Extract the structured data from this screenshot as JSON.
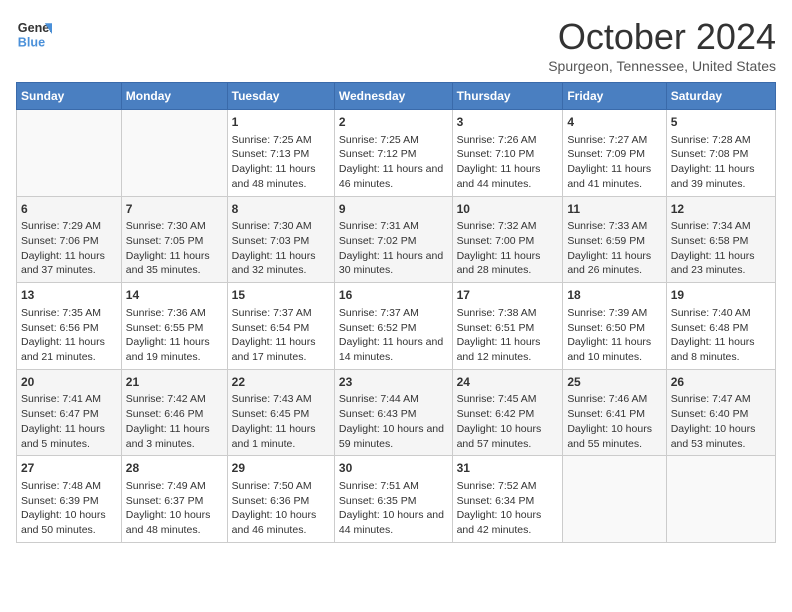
{
  "logo": {
    "line1": "General",
    "line2": "Blue"
  },
  "title": "October 2024",
  "location": "Spurgeon, Tennessee, United States",
  "days_of_week": [
    "Sunday",
    "Monday",
    "Tuesday",
    "Wednesday",
    "Thursday",
    "Friday",
    "Saturday"
  ],
  "weeks": [
    [
      {
        "day": "",
        "sunrise": "",
        "sunset": "",
        "daylight": ""
      },
      {
        "day": "",
        "sunrise": "",
        "sunset": "",
        "daylight": ""
      },
      {
        "day": "1",
        "sunrise": "Sunrise: 7:25 AM",
        "sunset": "Sunset: 7:13 PM",
        "daylight": "Daylight: 11 hours and 48 minutes."
      },
      {
        "day": "2",
        "sunrise": "Sunrise: 7:25 AM",
        "sunset": "Sunset: 7:12 PM",
        "daylight": "Daylight: 11 hours and 46 minutes."
      },
      {
        "day": "3",
        "sunrise": "Sunrise: 7:26 AM",
        "sunset": "Sunset: 7:10 PM",
        "daylight": "Daylight: 11 hours and 44 minutes."
      },
      {
        "day": "4",
        "sunrise": "Sunrise: 7:27 AM",
        "sunset": "Sunset: 7:09 PM",
        "daylight": "Daylight: 11 hours and 41 minutes."
      },
      {
        "day": "5",
        "sunrise": "Sunrise: 7:28 AM",
        "sunset": "Sunset: 7:08 PM",
        "daylight": "Daylight: 11 hours and 39 minutes."
      }
    ],
    [
      {
        "day": "6",
        "sunrise": "Sunrise: 7:29 AM",
        "sunset": "Sunset: 7:06 PM",
        "daylight": "Daylight: 11 hours and 37 minutes."
      },
      {
        "day": "7",
        "sunrise": "Sunrise: 7:30 AM",
        "sunset": "Sunset: 7:05 PM",
        "daylight": "Daylight: 11 hours and 35 minutes."
      },
      {
        "day": "8",
        "sunrise": "Sunrise: 7:30 AM",
        "sunset": "Sunset: 7:03 PM",
        "daylight": "Daylight: 11 hours and 32 minutes."
      },
      {
        "day": "9",
        "sunrise": "Sunrise: 7:31 AM",
        "sunset": "Sunset: 7:02 PM",
        "daylight": "Daylight: 11 hours and 30 minutes."
      },
      {
        "day": "10",
        "sunrise": "Sunrise: 7:32 AM",
        "sunset": "Sunset: 7:00 PM",
        "daylight": "Daylight: 11 hours and 28 minutes."
      },
      {
        "day": "11",
        "sunrise": "Sunrise: 7:33 AM",
        "sunset": "Sunset: 6:59 PM",
        "daylight": "Daylight: 11 hours and 26 minutes."
      },
      {
        "day": "12",
        "sunrise": "Sunrise: 7:34 AM",
        "sunset": "Sunset: 6:58 PM",
        "daylight": "Daylight: 11 hours and 23 minutes."
      }
    ],
    [
      {
        "day": "13",
        "sunrise": "Sunrise: 7:35 AM",
        "sunset": "Sunset: 6:56 PM",
        "daylight": "Daylight: 11 hours and 21 minutes."
      },
      {
        "day": "14",
        "sunrise": "Sunrise: 7:36 AM",
        "sunset": "Sunset: 6:55 PM",
        "daylight": "Daylight: 11 hours and 19 minutes."
      },
      {
        "day": "15",
        "sunrise": "Sunrise: 7:37 AM",
        "sunset": "Sunset: 6:54 PM",
        "daylight": "Daylight: 11 hours and 17 minutes."
      },
      {
        "day": "16",
        "sunrise": "Sunrise: 7:37 AM",
        "sunset": "Sunset: 6:52 PM",
        "daylight": "Daylight: 11 hours and 14 minutes."
      },
      {
        "day": "17",
        "sunrise": "Sunrise: 7:38 AM",
        "sunset": "Sunset: 6:51 PM",
        "daylight": "Daylight: 11 hours and 12 minutes."
      },
      {
        "day": "18",
        "sunrise": "Sunrise: 7:39 AM",
        "sunset": "Sunset: 6:50 PM",
        "daylight": "Daylight: 11 hours and 10 minutes."
      },
      {
        "day": "19",
        "sunrise": "Sunrise: 7:40 AM",
        "sunset": "Sunset: 6:48 PM",
        "daylight": "Daylight: 11 hours and 8 minutes."
      }
    ],
    [
      {
        "day": "20",
        "sunrise": "Sunrise: 7:41 AM",
        "sunset": "Sunset: 6:47 PM",
        "daylight": "Daylight: 11 hours and 5 minutes."
      },
      {
        "day": "21",
        "sunrise": "Sunrise: 7:42 AM",
        "sunset": "Sunset: 6:46 PM",
        "daylight": "Daylight: 11 hours and 3 minutes."
      },
      {
        "day": "22",
        "sunrise": "Sunrise: 7:43 AM",
        "sunset": "Sunset: 6:45 PM",
        "daylight": "Daylight: 11 hours and 1 minute."
      },
      {
        "day": "23",
        "sunrise": "Sunrise: 7:44 AM",
        "sunset": "Sunset: 6:43 PM",
        "daylight": "Daylight: 10 hours and 59 minutes."
      },
      {
        "day": "24",
        "sunrise": "Sunrise: 7:45 AM",
        "sunset": "Sunset: 6:42 PM",
        "daylight": "Daylight: 10 hours and 57 minutes."
      },
      {
        "day": "25",
        "sunrise": "Sunrise: 7:46 AM",
        "sunset": "Sunset: 6:41 PM",
        "daylight": "Daylight: 10 hours and 55 minutes."
      },
      {
        "day": "26",
        "sunrise": "Sunrise: 7:47 AM",
        "sunset": "Sunset: 6:40 PM",
        "daylight": "Daylight: 10 hours and 53 minutes."
      }
    ],
    [
      {
        "day": "27",
        "sunrise": "Sunrise: 7:48 AM",
        "sunset": "Sunset: 6:39 PM",
        "daylight": "Daylight: 10 hours and 50 minutes."
      },
      {
        "day": "28",
        "sunrise": "Sunrise: 7:49 AM",
        "sunset": "Sunset: 6:37 PM",
        "daylight": "Daylight: 10 hours and 48 minutes."
      },
      {
        "day": "29",
        "sunrise": "Sunrise: 7:50 AM",
        "sunset": "Sunset: 6:36 PM",
        "daylight": "Daylight: 10 hours and 46 minutes."
      },
      {
        "day": "30",
        "sunrise": "Sunrise: 7:51 AM",
        "sunset": "Sunset: 6:35 PM",
        "daylight": "Daylight: 10 hours and 44 minutes."
      },
      {
        "day": "31",
        "sunrise": "Sunrise: 7:52 AM",
        "sunset": "Sunset: 6:34 PM",
        "daylight": "Daylight: 10 hours and 42 minutes."
      },
      {
        "day": "",
        "sunrise": "",
        "sunset": "",
        "daylight": ""
      },
      {
        "day": "",
        "sunrise": "",
        "sunset": "",
        "daylight": ""
      }
    ]
  ]
}
